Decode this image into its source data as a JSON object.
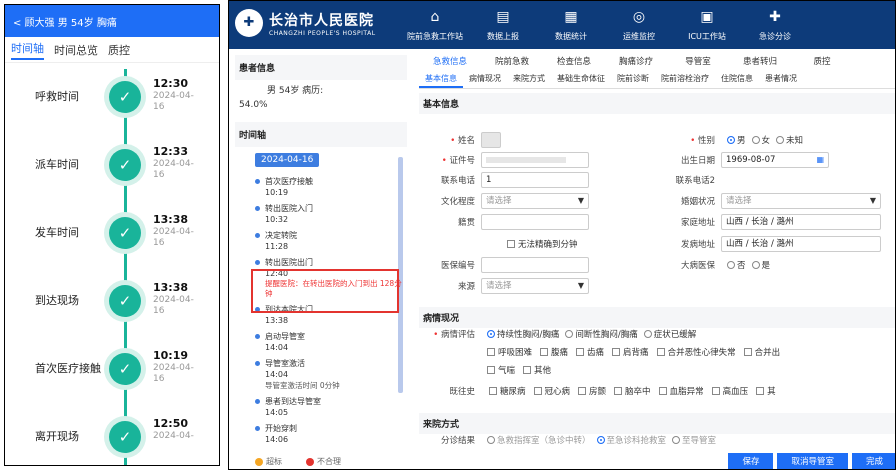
{
  "phone": {
    "header_title": "< 顾大强 男 54岁 胸痛",
    "tabs": [
      "时间轴",
      "时间总览",
      "质控"
    ],
    "events": [
      {
        "label": "呼救时间",
        "time": "12:30",
        "date": "2024-04-16"
      },
      {
        "label": "派车时间",
        "time": "12:33",
        "date": "2024-04-16"
      },
      {
        "label": "发车时间",
        "time": "13:38",
        "date": "2024-04-16"
      },
      {
        "label": "到达现场",
        "time": "13:38",
        "date": "2024-04-16"
      },
      {
        "label": "首次医疗接触",
        "time": "10:19",
        "date": "2024-04-16"
      },
      {
        "label": "离开现场",
        "time": "12:50",
        "date": "2024-04-"
      }
    ],
    "check_glyph": "✓"
  },
  "app": {
    "logo_cn": "长治市人民医院",
    "logo_en": "CHANGZHI PEOPLE'S HOSPITAL",
    "nav": [
      {
        "icon": "⌂",
        "label": "院前急救工作站"
      },
      {
        "icon": "▤",
        "label": "数据上报"
      },
      {
        "icon": "▦",
        "label": "数据统计"
      },
      {
        "icon": "◎",
        "label": "运维监控"
      },
      {
        "icon": "▣",
        "label": "ICU工作站"
      },
      {
        "icon": "✚",
        "label": "急诊分诊"
      }
    ],
    "patient": {
      "section": "患者信息",
      "line1": "男  54岁  病历:",
      "line2": "54.0%"
    },
    "timeline": {
      "section": "时间轴",
      "date": "2024-04-16",
      "items": [
        {
          "name": "首次医疗接触",
          "time": "10:19"
        },
        {
          "name": "转出医院入门",
          "time": "10:32"
        },
        {
          "name": "决定转院",
          "time": "11:28"
        },
        {
          "name": "转出医院出门",
          "time": "12:40",
          "note": "提醒医院：在转出医院的入门到出 128分钟"
        },
        {
          "name": "到达本院大门",
          "time": "13:38"
        },
        {
          "name": "启动导管室",
          "time": "14:04"
        },
        {
          "name": "导管室激活",
          "time": "14:04",
          "sub": "导管室激活时间 0分钟"
        },
        {
          "name": "患者到达导管室",
          "time": "14:05"
        },
        {
          "name": "开始穿刺",
          "time": "14:06"
        }
      ],
      "legend": [
        "超标",
        "不合理"
      ]
    },
    "tabs1": [
      "急救信息",
      "院前急救",
      "检查信息",
      "胸痛诊疗",
      "导管室",
      "患者转归",
      "质控"
    ],
    "tabs2": [
      "基本信息",
      "病情现况",
      "来院方式",
      "基础生命体征",
      "院前诊断",
      "院前溶栓治疗",
      "住院信息",
      "患者情况"
    ],
    "basic": {
      "section": "基本信息",
      "name_label": "姓名",
      "gender_label": "性别",
      "gender_opts": [
        "男",
        "女",
        "未知"
      ],
      "id_label": "证件号",
      "birth_label": "出生日期",
      "birth_value": "1969-08-07",
      "phone_label": "联系电话",
      "phone_value": "1",
      "phone2_label": "联系电话2",
      "edu_label": "文化程度",
      "select_placeholder": "请选择",
      "marital_label": "婚姻状况",
      "native_label": "籍贯",
      "home_label": "家庭地址",
      "home_value": "山西 / 长治 / 潞州",
      "nominute_label": "无法精确到分钟",
      "onset_label": "发病地址",
      "onset_value": "山西 / 长治 / 潞州",
      "insure_label": "医保编号",
      "illness_ins_label": "大病医保",
      "illness_opts": [
        "否",
        "是"
      ],
      "source_label": "来源"
    },
    "condition": {
      "section": "病情现况",
      "assess_label": "病情评估",
      "assess_opts": [
        "持续性胸闷/胸痛",
        "间断性胸闷/胸痛",
        "症状已缓解"
      ],
      "symptoms": [
        "呼吸困难",
        "腹痛",
        "齿痛",
        "肩背痛",
        "合并恶性心律失常",
        "合并出"
      ],
      "symptoms2": [
        "气喘",
        "其他"
      ],
      "history_label": "既往史",
      "history": [
        "糖尿病",
        "冠心病",
        "房颤",
        "脑卒中",
        "血脂异常",
        "高血压",
        "其"
      ]
    },
    "arrival": {
      "section": "来院方式",
      "row_label": "分诊结果",
      "opts": [
        "急救指挥室（急诊中转）",
        "至急诊科抢救室",
        "至导管室"
      ]
    },
    "buttons": [
      "保存",
      "取消导管室",
      "完成"
    ]
  }
}
